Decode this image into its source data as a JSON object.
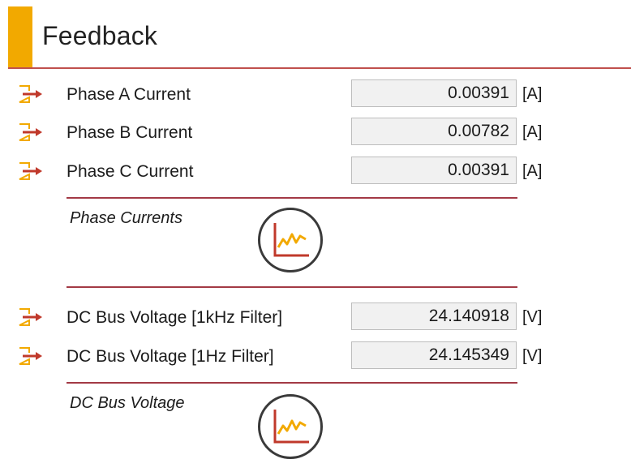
{
  "header": {
    "title": "Feedback"
  },
  "phase_rows": [
    {
      "label": "Phase A Current",
      "value": "0.00391",
      "unit": "[A]"
    },
    {
      "label": "Phase B Current",
      "value": "0.00782",
      "unit": "[A]"
    },
    {
      "label": "Phase C Current",
      "value": "0.00391",
      "unit": "[A]"
    }
  ],
  "phase_section": {
    "label": "Phase Currents"
  },
  "dc_rows": [
    {
      "label": "DC Bus Voltage [1kHz Filter]",
      "value": "24.140918",
      "unit": "[V]"
    },
    {
      "label": "DC Bus Voltage [1Hz Filter]",
      "value": "24.145349",
      "unit": "[V]"
    }
  ],
  "dc_section": {
    "label": "DC Bus Voltage"
  },
  "colors": {
    "accent": "#f2a900",
    "divider": "#c0504d",
    "arrow": "#c0392b",
    "field_bg": "#f1f1f1"
  },
  "icons": {
    "output_arrow": "output-arrow-icon",
    "chart": "line-chart-icon"
  }
}
